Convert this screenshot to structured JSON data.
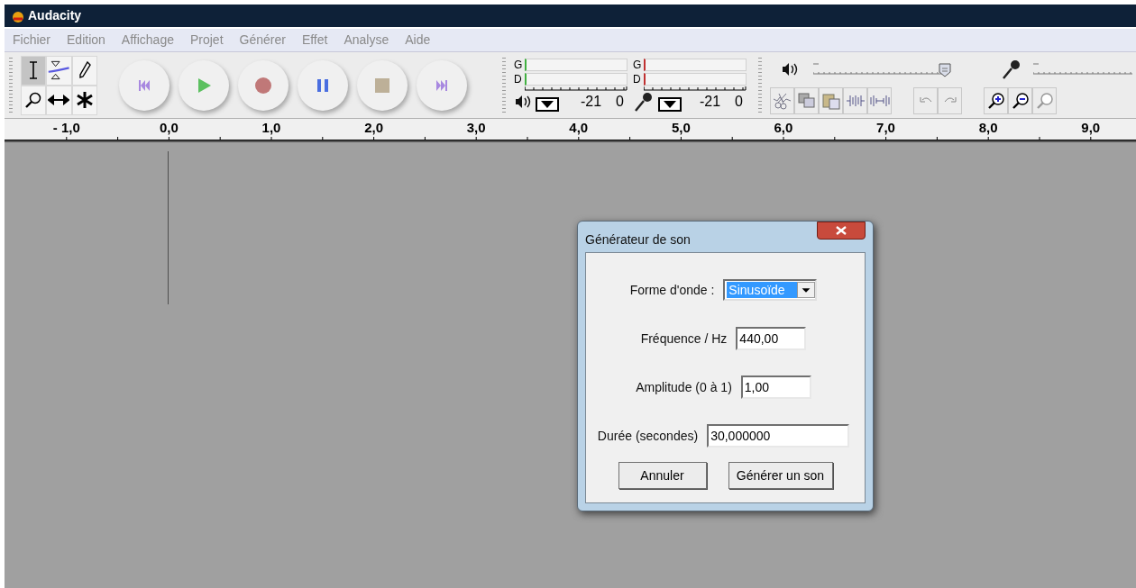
{
  "window": {
    "title": "Audacity"
  },
  "menu": [
    "Fichier",
    "Edition",
    "Affichage",
    "Projet",
    "Générer",
    "Effet",
    "Analyse",
    "Aide"
  ],
  "tools": [
    {
      "kind": "select",
      "selected": true
    },
    {
      "kind": "envelope",
      "selected": false
    },
    {
      "kind": "draw",
      "selected": false
    },
    {
      "kind": "zoom",
      "selected": false
    },
    {
      "kind": "timeshift",
      "selected": false
    },
    {
      "kind": "multi",
      "selected": false
    }
  ],
  "meters": [
    {
      "kind": "playback",
      "channels": [
        "G",
        "D"
      ],
      "scale": [
        "-21",
        "0"
      ]
    },
    {
      "kind": "record",
      "channels": [
        "G",
        "D"
      ],
      "scale": [
        "-21",
        "0"
      ]
    }
  ],
  "mixer": {
    "playback": {
      "level": 0.97
    }
  },
  "ruler": {
    "labels": [
      "- 1,0",
      "0,0",
      "1,0",
      "2,0",
      "3,0",
      "4,0",
      "5,0",
      "6,0",
      "7,0",
      "8,0",
      "9,0"
    ]
  },
  "dialog": {
    "title": "Générateur de son",
    "fields": [
      {
        "kind": "dropdown",
        "label": "Forme d'onde :",
        "value": "Sinusoïde"
      },
      {
        "kind": "text",
        "label": "Fréquence / Hz",
        "value": "440,00"
      },
      {
        "kind": "text",
        "label": "Amplitude (0 à 1)",
        "value": "1,00"
      },
      {
        "kind": "text",
        "label": "Durée (secondes)",
        "value": "30,000000"
      }
    ],
    "buttons": [
      "Annuler",
      "Générer un son"
    ]
  }
}
